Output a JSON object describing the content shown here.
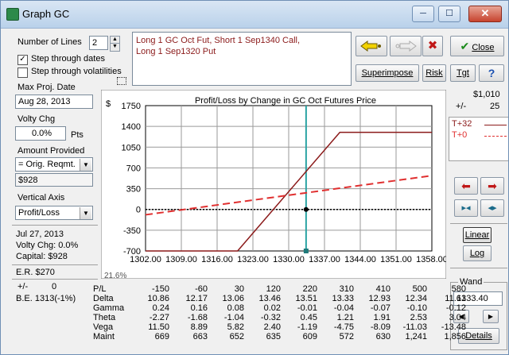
{
  "window": {
    "title": "Graph GC",
    "minimize_glyph": "─",
    "maximize_glyph": "☐",
    "close_glyph": "✕"
  },
  "left": {
    "number_of_lines_label": "Number of Lines",
    "number_of_lines_value": "2",
    "step_dates_label": "Step through dates",
    "step_dates_checked": "✓",
    "step_vols_label": "Step through volatilities",
    "max_proj_date_label": "Max Proj. Date",
    "max_proj_date_value": "Aug 28, 2013",
    "volty_chg_label": "Volty Chg",
    "volty_chg_value": "0.0%",
    "volty_chg_unit": "Pts",
    "amount_provided_label": "Amount Provided",
    "amount_provided_value": "= Orig. Reqmt.",
    "amount_value": "$928",
    "vertical_axis_label": "Vertical Axis",
    "vertical_axis_value": "Profit/Loss",
    "info_date": "Jul 27, 2013",
    "info_volty": "Volty Chg:  0.0%",
    "info_capital": "Capital:  $928",
    "er": "E.R. $270",
    "pm_label": "+/-",
    "pm_value": "0",
    "be": "B.E. 1313(-1%)"
  },
  "description": {
    "line1": "Long 1 GC Oct Fut, Short 1 Sep1340 Call,",
    "line2": "Long 1 Sep1320 Put"
  },
  "toolbar": {
    "superimpose": "Superimpose",
    "risk": "Risk",
    "tgt": "Tgt",
    "help": "?",
    "close_label": "Close",
    "close_check": "✔",
    "delete_glyph": "✖"
  },
  "right": {
    "value_top": "$1,010",
    "pm_label": "+/-",
    "pm_value": "25",
    "legend": [
      {
        "label": "T+32",
        "color": "#8b1a1a"
      },
      {
        "label": "T+0",
        "color": "#e03030"
      }
    ],
    "linear": "Linear",
    "log": "Log",
    "wand_label": "Wand",
    "wand_value": "1333.40",
    "details": "Details"
  },
  "chart_data": {
    "type": "line",
    "title": "Profit/Loss by Change in GC Oct Futures Price",
    "ylabel": "$",
    "xlim": [
      1302,
      1358
    ],
    "ylim": [
      -700,
      1750
    ],
    "yticks": [
      1750,
      1400,
      1050,
      700,
      350,
      0,
      -350,
      -700
    ],
    "xticks": [
      1302.0,
      1309.0,
      1316.0,
      1323.0,
      1330.0,
      1337.0,
      1344.0,
      1351.0,
      1358.0
    ],
    "partial_label": "21.6%",
    "wand_x": 1333.4,
    "series": [
      {
        "name": "T+32",
        "color": "#8b1a1a",
        "style": "solid",
        "x": [
          1302,
          1320,
          1340,
          1358
        ],
        "y": [
          -700,
          -700,
          1300,
          1300
        ]
      },
      {
        "name": "T+0",
        "color": "#e03030",
        "style": "dashed",
        "x": [
          1302,
          1358
        ],
        "y": [
          -90,
          570
        ]
      }
    ],
    "marker": {
      "x": 1333.4,
      "y": 0
    }
  },
  "greeks": {
    "rows": [
      {
        "label": "P/L",
        "values": [
          "-150",
          "-60",
          "30",
          "120",
          "220",
          "310",
          "410",
          "500",
          "580"
        ]
      },
      {
        "label": "Delta",
        "values": [
          "10.86",
          "12.17",
          "13.06",
          "13.46",
          "13.51",
          "13.33",
          "12.93",
          "12.34",
          "11.61"
        ]
      },
      {
        "label": "Gamma",
        "values": [
          "0.24",
          "0.16",
          "0.08",
          "0.02",
          "-0.01",
          "-0.04",
          "-0.07",
          "-0.10",
          "-0.12"
        ]
      },
      {
        "label": "Theta",
        "values": [
          "-2.27",
          "-1.68",
          "-1.04",
          "-0.32",
          "0.45",
          "1.21",
          "1.91",
          "2.53",
          "3.04"
        ]
      },
      {
        "label": "Vega",
        "values": [
          "11.50",
          "8.89",
          "5.82",
          "2.40",
          "-1.19",
          "-4.75",
          "-8.09",
          "-11.03",
          "-13.48"
        ]
      },
      {
        "label": "Maint",
        "values": [
          "669",
          "663",
          "652",
          "635",
          "609",
          "572",
          "630",
          "1,241",
          "1,856"
        ]
      }
    ]
  }
}
